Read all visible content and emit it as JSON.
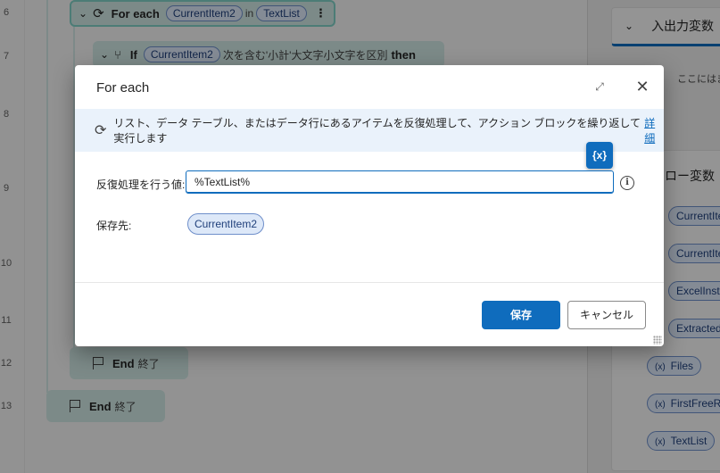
{
  "line_numbers": [
    "6",
    "7",
    "8",
    "9",
    "10",
    "11",
    "12",
    "13"
  ],
  "flow": {
    "foreach_keyword": "For each",
    "foreach_var": "CurrentItem2",
    "foreach_in": "in",
    "foreach_list": "TextList",
    "if_keyword": "If",
    "if_var": "CurrentItem2",
    "if_text": "次を含む'小計'大文字小文字を区別",
    "if_then": "then",
    "end_keyword": "End",
    "end_jp": "終了"
  },
  "right_panel": {
    "io_title": "入出力変数",
    "io_empty": "ここにはま",
    "flow_vars_title": "ロー変数",
    "variables": [
      "CurrentIter",
      "CurrentIter",
      "ExcelInstan",
      "ExtractedP",
      "Files",
      "FirstFreeRo",
      "TextList"
    ],
    "var_icon": "(x)"
  },
  "dialog": {
    "title": "For each",
    "expand_icon": "⤢",
    "close_icon": "✕",
    "info_text": "リスト、データ テーブル、またはデータ行にあるアイテムを反復処理して、アクション ブロックを繰り返して実行します",
    "info_link": "詳細",
    "fx_label": "{x}",
    "iterate_label": "反復処理を行う値:",
    "iterate_value": "%TextList%",
    "save_to_label": "保存先:",
    "save_to_value": "CurrentItem2",
    "save_button": "保存",
    "cancel_button": "キャンセル"
  },
  "colors": {
    "accent": "#0f6cbd",
    "info_bar": "#eaf2fb",
    "variable_pill": "#dde8f8"
  }
}
